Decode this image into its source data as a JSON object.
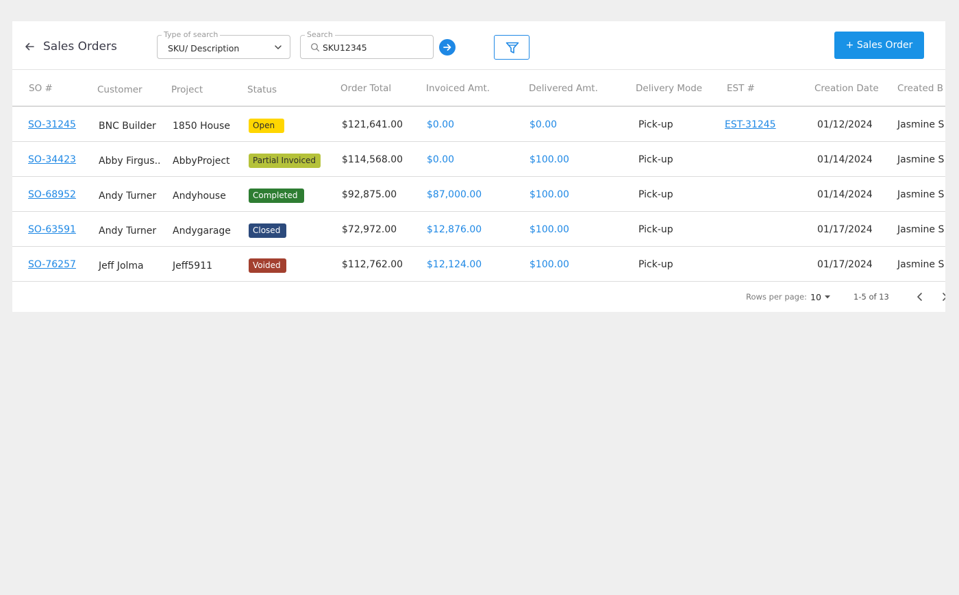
{
  "header": {
    "title": "Sales Orders",
    "search_type": {
      "legend": "Type of search",
      "value": "SKU/ Description"
    },
    "search": {
      "legend": "Search",
      "value": "SKU12345"
    },
    "add_button": "+ Sales Order"
  },
  "table": {
    "columns": [
      "SO #",
      "Customer",
      "Project",
      "Status",
      "Order Total",
      "Invoiced Amt.",
      "Delivered Amt.",
      "Delivery Mode",
      "EST #",
      "Creation Date",
      "Created B"
    ],
    "rows": [
      {
        "so": "SO-31245",
        "customer": "BNC Builder",
        "project": "1850 House",
        "status": "Open",
        "status_bg": "#ffd600",
        "status_fg": "#2b2b2b",
        "total": "$121,641.00",
        "invoiced": "$0.00",
        "delivered": "$0.00",
        "mode": "Pick-up",
        "est": "EST-31245",
        "date": "01/12/2024",
        "created_by": "Jasmine S"
      },
      {
        "so": "SO-34423",
        "customer": "Abby Firgus..",
        "project": "AbbyProject",
        "status": "Partial Invoiced",
        "status_bg": "#b5c23a",
        "status_fg": "#2b2b2b",
        "total": "$114,568.00",
        "invoiced": "$0.00",
        "delivered": "$100.00",
        "mode": "Pick-up",
        "est": "",
        "date": "01/14/2024",
        "created_by": "Jasmine S"
      },
      {
        "so": "SO-68952",
        "customer": "Andy Turner",
        "project": "Andyhouse",
        "status": "Completed",
        "status_bg": "#2e7d32",
        "status_fg": "#ffffff",
        "total": "$92,875.00",
        "invoiced": "$87,000.00",
        "delivered": "$100.00",
        "mode": "Pick-up",
        "est": "",
        "date": "01/14/2024",
        "created_by": "Jasmine S"
      },
      {
        "so": "SO-63591",
        "customer": "Andy Turner",
        "project": "Andygarage",
        "status": "Closed",
        "status_bg": "#2c4a7c",
        "status_fg": "#ffffff",
        "total": "$72,972.00",
        "invoiced": "$12,876.00",
        "delivered": "$100.00",
        "mode": "Pick-up",
        "est": "",
        "date": "01/17/2024",
        "created_by": "Jasmine S"
      },
      {
        "so": "SO-76257",
        "customer": "Jeff Jolma",
        "project": "Jeff5911",
        "status": "Voided",
        "status_bg": "#a3402f",
        "status_fg": "#ffffff",
        "total": "$112,762.00",
        "invoiced": "$12,124.00",
        "delivered": "$100.00",
        "mode": "Pick-up",
        "est": "",
        "date": "01/17/2024",
        "created_by": "Jasmine S"
      }
    ]
  },
  "footer": {
    "rows_per_page_label": "Rows per page:",
    "rows_per_page_value": "10",
    "range": "1-5 of 13"
  },
  "icons": [
    "back-arrow-icon",
    "chevron-down-icon",
    "search-icon",
    "arrow-right-circle-icon",
    "filter-icon",
    "caret-down-icon",
    "chevron-left-icon",
    "chevron-right-icon"
  ],
  "colors": {
    "accent": "#1e88e5",
    "button": "#1992e6"
  }
}
